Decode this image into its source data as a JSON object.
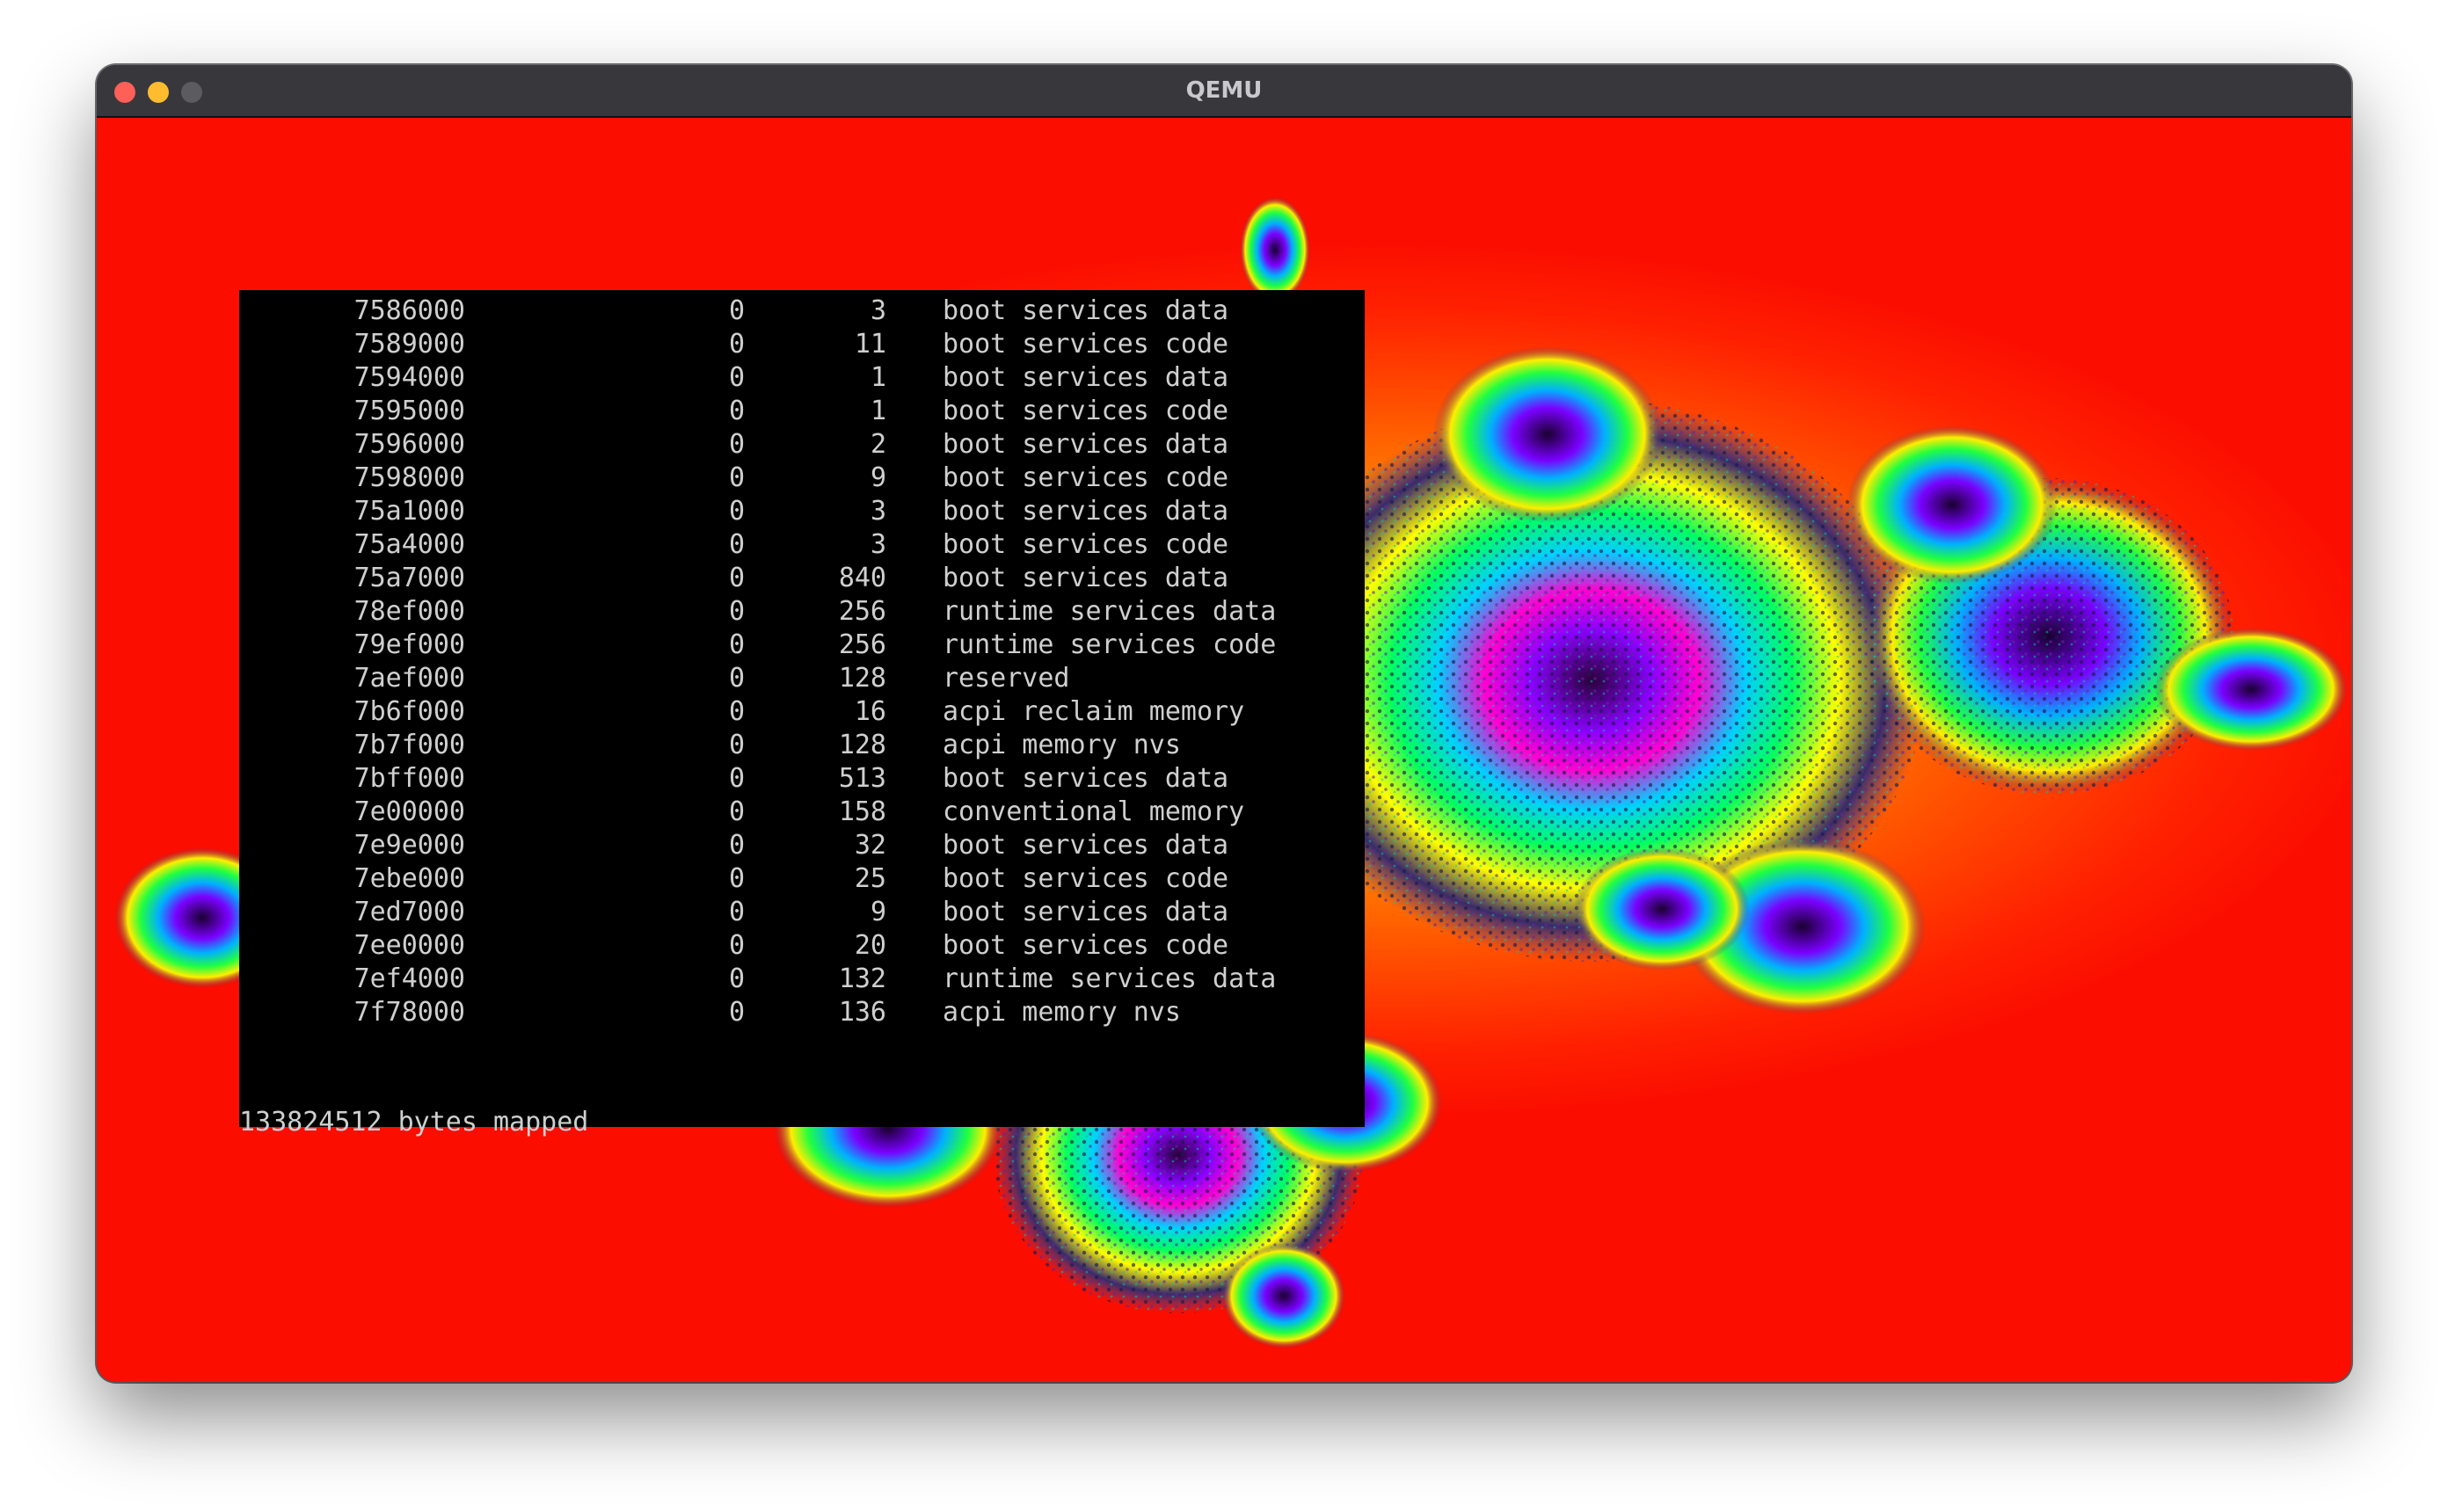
{
  "window": {
    "title": "QEMU"
  },
  "colors": {
    "background_red": "#fb0d00",
    "console_bg": "#000000",
    "console_text": "#cfcfcf"
  },
  "console": {
    "rows": [
      {
        "address": "7586000",
        "attribute": "0",
        "pages": "3",
        "type": "boot services data"
      },
      {
        "address": "7589000",
        "attribute": "0",
        "pages": "11",
        "type": "boot services code"
      },
      {
        "address": "7594000",
        "attribute": "0",
        "pages": "1",
        "type": "boot services data"
      },
      {
        "address": "7595000",
        "attribute": "0",
        "pages": "1",
        "type": "boot services code"
      },
      {
        "address": "7596000",
        "attribute": "0",
        "pages": "2",
        "type": "boot services data"
      },
      {
        "address": "7598000",
        "attribute": "0",
        "pages": "9",
        "type": "boot services code"
      },
      {
        "address": "75a1000",
        "attribute": "0",
        "pages": "3",
        "type": "boot services data"
      },
      {
        "address": "75a4000",
        "attribute": "0",
        "pages": "3",
        "type": "boot services code"
      },
      {
        "address": "75a7000",
        "attribute": "0",
        "pages": "840",
        "type": "boot services data"
      },
      {
        "address": "78ef000",
        "attribute": "0",
        "pages": "256",
        "type": "runtime services data"
      },
      {
        "address": "79ef000",
        "attribute": "0",
        "pages": "256",
        "type": "runtime services code"
      },
      {
        "address": "7aef000",
        "attribute": "0",
        "pages": "128",
        "type": "reserved"
      },
      {
        "address": "7b6f000",
        "attribute": "0",
        "pages": "16",
        "type": "acpi reclaim memory"
      },
      {
        "address": "7b7f000",
        "attribute": "0",
        "pages": "128",
        "type": "acpi memory nvs"
      },
      {
        "address": "7bff000",
        "attribute": "0",
        "pages": "513",
        "type": "boot services data"
      },
      {
        "address": "7e00000",
        "attribute": "0",
        "pages": "158",
        "type": "conventional memory"
      },
      {
        "address": "7e9e000",
        "attribute": "0",
        "pages": "32",
        "type": "boot services data"
      },
      {
        "address": "7ebe000",
        "attribute": "0",
        "pages": "25",
        "type": "boot services code"
      },
      {
        "address": "7ed7000",
        "attribute": "0",
        "pages": "9",
        "type": "boot services data"
      },
      {
        "address": "7ee0000",
        "attribute": "0",
        "pages": "20",
        "type": "boot services code"
      },
      {
        "address": "7ef4000",
        "attribute": "0",
        "pages": "132",
        "type": "runtime services data"
      },
      {
        "address": "7f78000",
        "attribute": "0",
        "pages": "136",
        "type": "acpi memory nvs"
      }
    ],
    "summary": "133824512 bytes mapped"
  }
}
